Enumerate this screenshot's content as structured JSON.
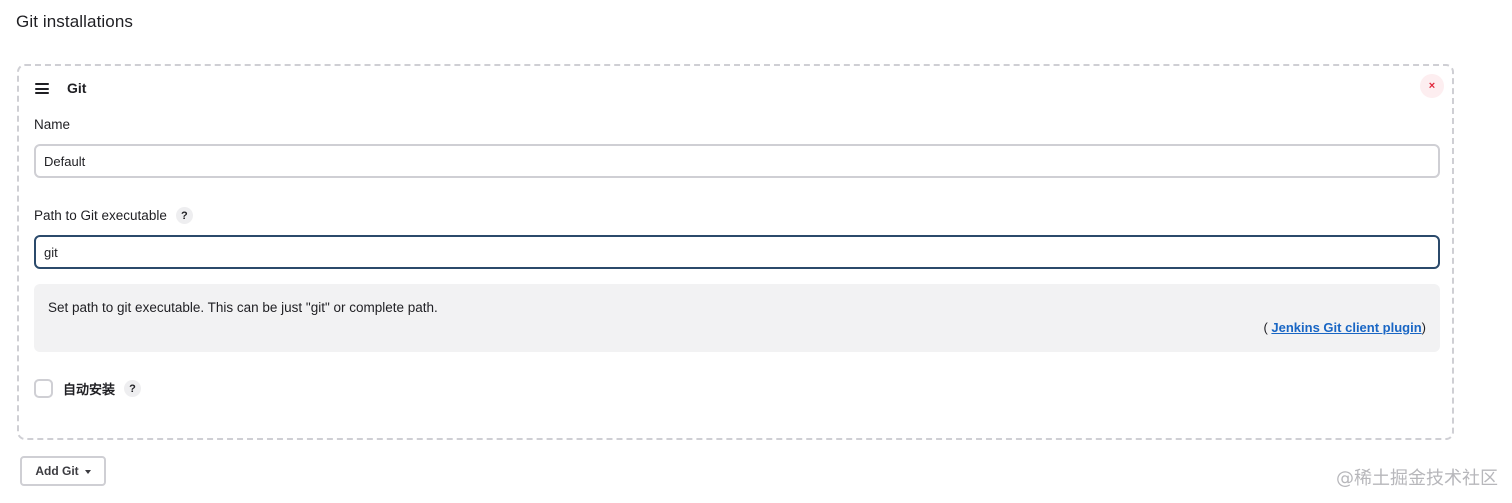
{
  "section": {
    "title": "Git installations"
  },
  "installation": {
    "title": "Git",
    "delete_symbol": "×",
    "name_field": {
      "label": "Name",
      "value": "Default"
    },
    "path_field": {
      "label": "Path to Git executable",
      "help_symbol": "?",
      "value": "git"
    },
    "help_panel": {
      "text": "Set path to git executable. This can be just \"git\" or complete path.",
      "source_prefix": "( ",
      "source_link": "Jenkins Git client plugin",
      "source_suffix": ")"
    },
    "autoinstall": {
      "label": "自动安装",
      "help_symbol": "?",
      "checked": false
    }
  },
  "add_button": {
    "label": "Add Git"
  },
  "watermark": "@稀土掘金技术社区",
  "colors": {
    "text": "#1f1f23",
    "link": "#1966c4",
    "delete": "#e0263b",
    "focused_border": "#2b4a6b",
    "dashed_border": "#cfcfd4",
    "help_background": "#f2f2f3"
  },
  "icons": {
    "drag": "drag-handle-icon",
    "delete": "close-icon",
    "help": "help-icon",
    "dropdown": "chevron-down-icon"
  }
}
